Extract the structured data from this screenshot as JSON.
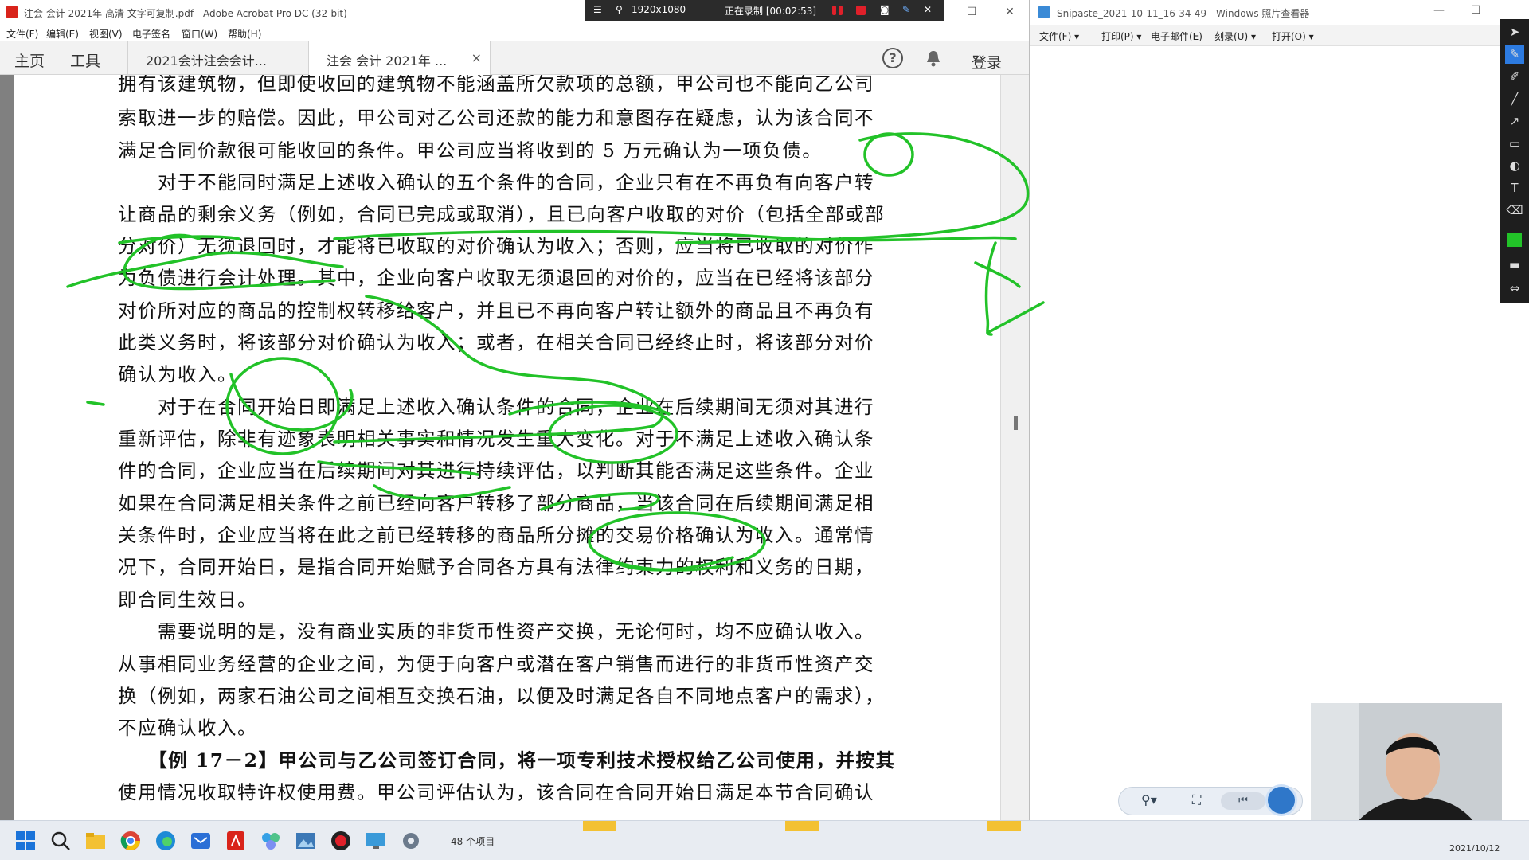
{
  "acrobat": {
    "window_title": "注会 会计 2021年 高清 文字可复制.pdf - Adobe Acrobat Pro DC (32-bit)",
    "menu": [
      "文件(F)",
      "编辑(E)",
      "视图(V)",
      "电子签名",
      "窗口(W)",
      "帮助(H)"
    ],
    "nav_home": "主页",
    "nav_tools": "工具",
    "tabs": [
      {
        "label": "2021会计注会会计..."
      },
      {
        "label": "注会 会计 2021年 ..."
      }
    ],
    "tab_close": "×",
    "help_glyph": "?",
    "login": "登录",
    "window_buttons": {
      "minimize": "—",
      "maximize": "☐",
      "close": "✕"
    }
  },
  "recorder": {
    "resolution": "1920x1080",
    "status": "正在录制 [00:02:53]"
  },
  "document": {
    "lines": [
      "拥有该建筑物，但即使收回的建筑物不能涵盖所欠款项的总额，甲公司也不能向乙公司",
      "索取进一步的赔偿。因此，甲公司对乙公司还款的能力和意图存在疑虑，认为该合同不",
      "满足合同价款很可能收回的条件。甲公司应当将收到的 5 万元确认为一项负债。",
      "　　对于不能同时满足上述收入确认的五个条件的合同，企业只有在不再负有向客户转",
      "让商品的剩余义务（例如，合同已完成或取消），且已向客户收取的对价（包括全部或部",
      "分对价）无须退回时，才能将已收取的对价确认为收入；否则，应当将已收取的对价作",
      "为负债进行会计处理。其中，企业向客户收取无须退回的对价的，应当在已经将该部分",
      "对价所对应的商品的控制权转移给客户，并且已不再向客户转让额外的商品且不再负有",
      "此类义务时，将该部分对价确认为收入；或者，在相关合同已经终止时，将该部分对价",
      "确认为收入。",
      "　　对于在合同开始日即满足上述收入确认条件的合同，企业在后续期间无须对其进行",
      "重新评估，除非有迹象表明相关事实和情况发生重大变化。对于不满足上述收入确认条",
      "件的合同，企业应当在后续期间对其进行持续评估，以判断其能否满足这些条件。企业",
      "如果在合同满足相关条件之前已经向客户转移了部分商品，当该合同在后续期间满足相",
      "关条件时，企业应当将在此之前已经转移的商品所分摊的交易价格确认为收入。通常情",
      "况下，合同开始日，是指合同开始赋予合同各方具有法律约束力的权利和义务的日期，",
      "即合同生效日。",
      "　　需要说明的是，没有商业实质的非货币性资产交换，无论何时，均不应确认收入。",
      "从事相同业务经营的企业之间，为便于向客户或潜在客户销售而进行的非货币性资产交",
      "换（例如，两家石油公司之间相互交换石油，以便及时满足各自不同地点客户的需求），",
      "不应确认收入。",
      "　　【例 17－2】甲公司与乙公司签订合同，将一项专利技术授权给乙公司使用，并按其",
      "使用情况收取特许权使用费。甲公司评估认为，该合同在合同开始日满足本节合同确认"
    ]
  },
  "photos": {
    "window_title": "Snipaste_2021-10-11_16-34-49 - Windows 照片查看器",
    "menu": [
      "文件(F) ▾",
      "打印(P) ▾",
      "电子邮件(E)",
      "刻录(U) ▾",
      "打开(O) ▾"
    ]
  },
  "taskbar": {
    "items_label": "48 个项目",
    "date": "2021/10/12"
  },
  "colors": {
    "ink": "#22c228",
    "acrobat_red": "#d9241b"
  }
}
